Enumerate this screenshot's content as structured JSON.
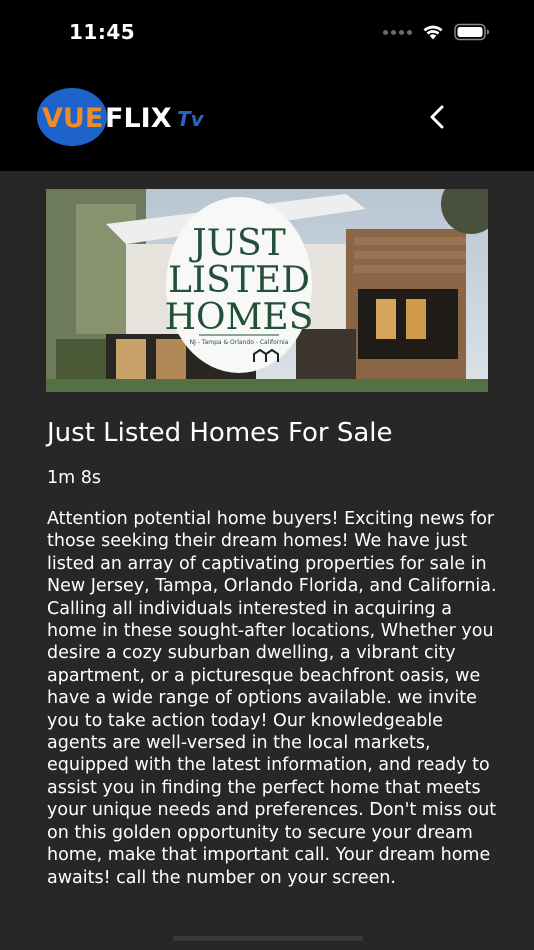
{
  "status_bar": {
    "time": "11:45"
  },
  "header": {
    "logo_vue": "VUE",
    "logo_flix": "FLIX",
    "logo_tv": "Tv"
  },
  "hero": {
    "line1": "JUST",
    "line2": "LISTED",
    "line3": "HOMES",
    "subtitle": "NJ - Tampa & Orlando - California"
  },
  "video": {
    "title": "Just Listed Homes For Sale",
    "duration": "1m 8s",
    "description": "Attention potential home buyers! Exciting news for those seeking their dream homes! We have just listed an array of captivating properties for sale in New Jersey, Tampa, Orlando Florida, and California. Calling all individuals interested in acquiring a home in these sought-after locations, Whether you desire a cozy suburban dwelling, a vibrant city apartment, or a picturesque beachfront oasis, we have a wide range of options available. we invite you to take action today! Our knowledgeable agents are well-versed in the local markets, equipped with the latest information, and ready to assist you in finding the perfect home that meets your unique needs and preferences. Don't miss out on this golden opportunity to secure your dream home, make that important call. Your dream home awaits! call the number on your screen."
  },
  "colors": {
    "background": "#272727",
    "header": "#000000",
    "logo_blue": "#1e63c9",
    "logo_orange": "#f08a24",
    "hero_text": "#22503c"
  }
}
